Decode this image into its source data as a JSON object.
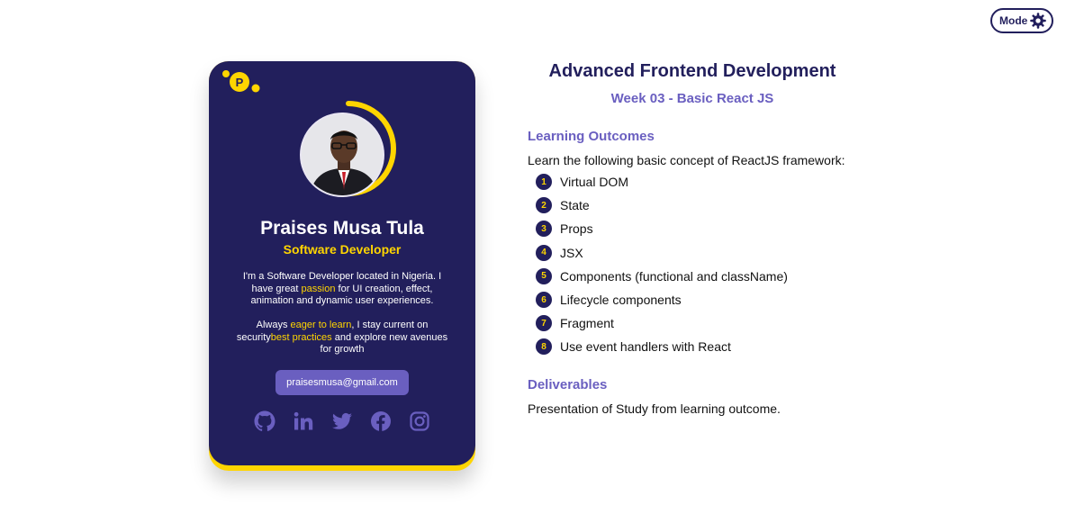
{
  "mode_toggle": {
    "label": "Mode",
    "icon": "gear-icon"
  },
  "card": {
    "logo_letter": "P",
    "name": "Praises Musa Tula",
    "role": "Software Developer",
    "bio1": {
      "pre": "I'm a Software Developer located in Nigeria. I have great ",
      "hl": "passion",
      "post": " for UI creation, effect, animation and dynamic user experiences."
    },
    "bio2": {
      "pre": "Always ",
      "hl1": "eager to learn",
      "mid": ", I stay current on security",
      "hl2": "best practices",
      "post": " and explore new avenues for growth"
    },
    "email": "praisesmusa@gmail.com",
    "socials": [
      "github-icon",
      "linkedin-icon",
      "twitter-icon",
      "facebook-icon",
      "instagram-icon"
    ]
  },
  "course": {
    "title": "Advanced Frontend Development",
    "week": "Week 03 - Basic React JS",
    "learning_heading": "Learning Outcomes",
    "intro": "Learn the following basic concept of ReactJS framework:",
    "outcomes": [
      {
        "num": "1",
        "text": "Virtual DOM"
      },
      {
        "num": "2",
        "text": "State"
      },
      {
        "num": "3",
        "text": "Props"
      },
      {
        "num": "4",
        "text": "JSX"
      },
      {
        "num": "5",
        "text": "Components (functional and className)"
      },
      {
        "num": "6",
        "text": "Lifecycle components"
      },
      {
        "num": "7",
        "text": "Fragment"
      },
      {
        "num": "8",
        "text": "Use event handlers with React"
      }
    ],
    "deliverables_heading": "Deliverables",
    "deliverables_text": "Presentation of Study from learning outcome."
  },
  "colors": {
    "navy": "#221f5c",
    "accent": "#ffd500",
    "purple": "#6a5fc0"
  }
}
